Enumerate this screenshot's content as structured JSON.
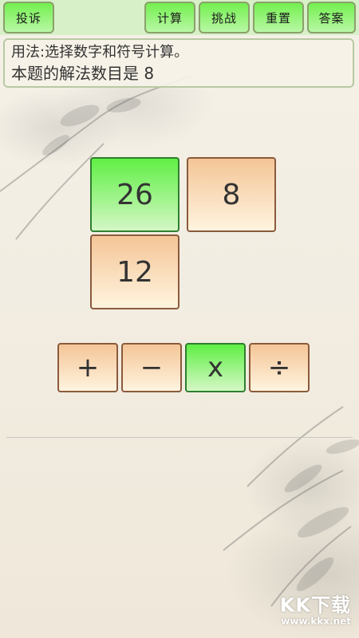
{
  "topbar": {
    "complain_label": "投诉",
    "calc_label": "计算",
    "challenge_label": "挑战",
    "reset_label": "重置",
    "answer_label": "答案"
  },
  "info": {
    "usage_text": "用法:选择数字和符号计算。",
    "solution_text": "本题的解法数目是 8"
  },
  "numbers": [
    {
      "value": "26",
      "selected": true
    },
    {
      "value": "8",
      "selected": false
    },
    {
      "value": "12",
      "selected": false
    }
  ],
  "operators": [
    {
      "symbol": "+",
      "selected": false
    },
    {
      "symbol": "−",
      "selected": false
    },
    {
      "symbol": "x",
      "selected": true
    },
    {
      "symbol": "÷",
      "selected": false
    }
  ],
  "watermark": {
    "brand": "KK下载",
    "url": "www.kkx.net"
  }
}
